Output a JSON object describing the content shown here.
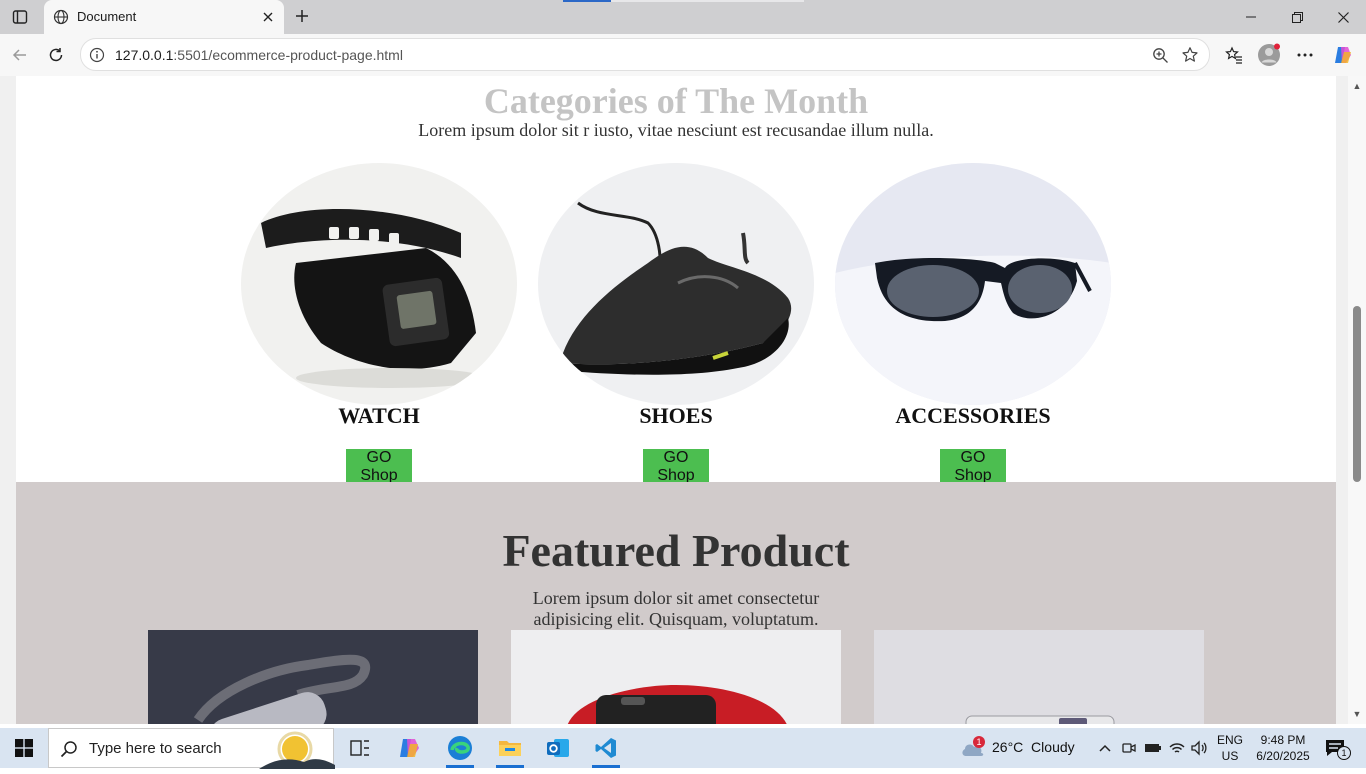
{
  "browser": {
    "tab_title": "Document",
    "url_host": "127.0.0.1",
    "url_rest": ":5501/ecommerce-product-page.html"
  },
  "categories": {
    "title": "Categories of The Month",
    "subtitle": "Lorem ipsum dolor sit r iusto, vitae nesciunt est recusandae illum nulla.",
    "items": [
      {
        "name": "WATCH",
        "button": "GO Shop"
      },
      {
        "name": "SHOES",
        "button": "GO Shop"
      },
      {
        "name": "ACCESSORIES",
        "button": "GO Shop"
      }
    ]
  },
  "featured": {
    "title": "Featured Product",
    "description": "Lorem ipsum dolor sit amet consectetur adipisicing elit. Quisquam, voluptatum."
  },
  "taskbar": {
    "search_placeholder": "Type here to search",
    "weather": "26°C  Cloudy",
    "weather_badge": "1",
    "lang_top": "ENG",
    "lang_bottom": "US",
    "time": "9:48 PM",
    "date": "6/20/2025",
    "notification_count": "1"
  },
  "colors": {
    "accent_button": "#4cbe50",
    "featured_bg": "#d1cbcb",
    "category_title": "#c4c4c4"
  }
}
